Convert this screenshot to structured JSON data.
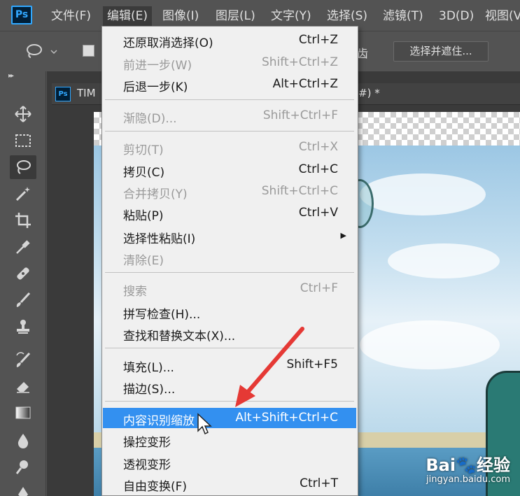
{
  "app": {
    "logo": "Ps"
  },
  "menubar": {
    "items": [
      "文件(F)",
      "编辑(E)",
      "图像(I)",
      "图层(L)",
      "文字(Y)",
      "选择(S)",
      "滤镜(T)",
      "3D(D)",
      "视图(V"
    ]
  },
  "options_bar": {
    "partial_text": "齿",
    "select_and_mask": "选择并遮住..."
  },
  "document": {
    "tab_logo": "Ps",
    "tab_name": "TIM",
    "tab_tail": "#) *"
  },
  "edit_menu": {
    "items": [
      {
        "label": "还原取消选择(O)",
        "shortcut": "Ctrl+Z",
        "disabled": false
      },
      {
        "label": "前进一步(W)",
        "shortcut": "Shift+Ctrl+Z",
        "disabled": true
      },
      {
        "label": "后退一步(K)",
        "shortcut": "Alt+Ctrl+Z",
        "disabled": false
      },
      {
        "label": "渐隐(D)...",
        "shortcut": "Shift+Ctrl+F",
        "disabled": true
      },
      {
        "label": "剪切(T)",
        "shortcut": "Ctrl+X",
        "disabled": true
      },
      {
        "label": "拷贝(C)",
        "shortcut": "Ctrl+C",
        "disabled": false
      },
      {
        "label": "合并拷贝(Y)",
        "shortcut": "Shift+Ctrl+C",
        "disabled": true
      },
      {
        "label": "粘贴(P)",
        "shortcut": "Ctrl+V",
        "disabled": false
      },
      {
        "label": "选择性粘贴(I)",
        "shortcut": "",
        "disabled": false,
        "submenu": true
      },
      {
        "label": "清除(E)",
        "shortcut": "",
        "disabled": true
      },
      {
        "label": "搜索",
        "shortcut": "Ctrl+F",
        "disabled": true
      },
      {
        "label": "拼写检查(H)...",
        "shortcut": "",
        "disabled": false
      },
      {
        "label": "查找和替换文本(X)...",
        "shortcut": "",
        "disabled": false
      },
      {
        "label": "填充(L)...",
        "shortcut": "Shift+F5",
        "disabled": false
      },
      {
        "label": "描边(S)...",
        "shortcut": "",
        "disabled": false
      },
      {
        "label": "内容识别缩放",
        "shortcut": "Alt+Shift+Ctrl+C",
        "disabled": false,
        "highlighted": true
      },
      {
        "label": "操控变形",
        "shortcut": "",
        "disabled": false
      },
      {
        "label": "透视变形",
        "shortcut": "",
        "disabled": false
      },
      {
        "label": "自由变换(F)",
        "shortcut": "Ctrl+T",
        "disabled": false
      }
    ],
    "submenu_icon": "submenu-triangle-icon"
  },
  "tools": [
    "move-icon",
    "marquee-icon",
    "lasso-icon",
    "magic-wand-icon",
    "crop-icon",
    "eyedropper-icon",
    "healing-brush-icon",
    "brush-icon",
    "clone-stamp-icon",
    "history-brush-icon",
    "eraser-icon",
    "gradient-icon",
    "blur-icon",
    "dodge-icon",
    "pen-icon"
  ],
  "watermark": {
    "main": "Bai🐾经验",
    "sub": "jingyan.baidu.com"
  },
  "colors": {
    "highlight": "#3390f0",
    "arrow": "#e53935",
    "ps_blue": "#31a8ff"
  }
}
